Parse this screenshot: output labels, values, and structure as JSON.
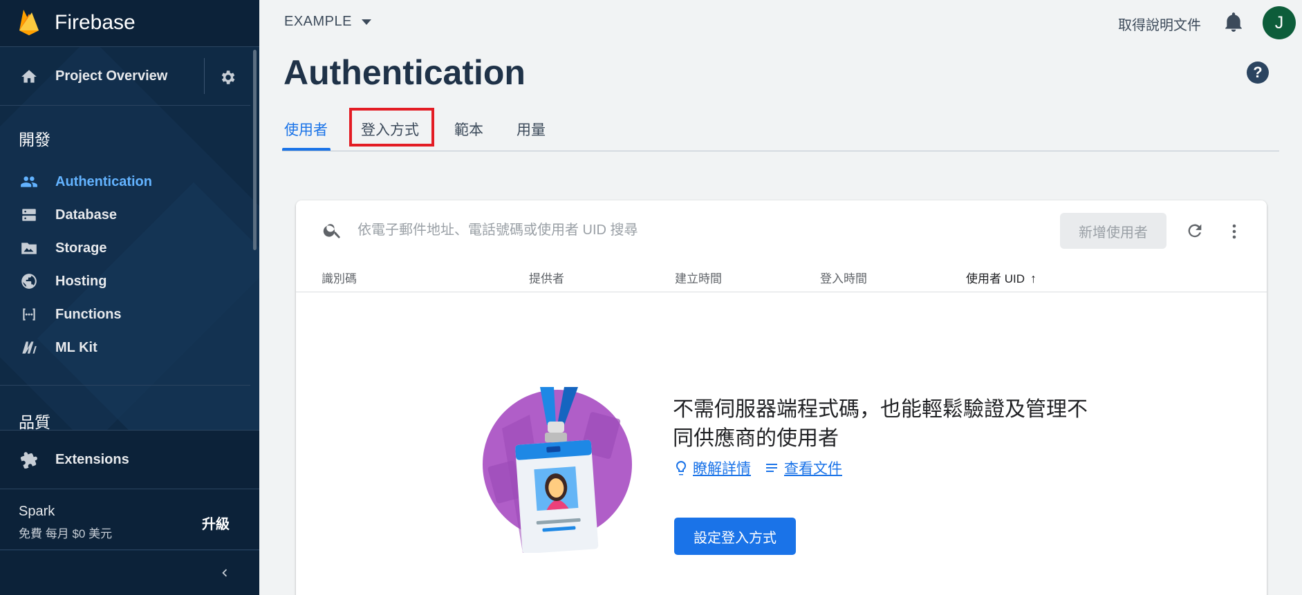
{
  "app": {
    "brand": "Firebase"
  },
  "sidebar": {
    "overview_label": "Project Overview",
    "section_develop": "開發",
    "develop_items": [
      {
        "label": "Authentication",
        "icon": "people-icon"
      },
      {
        "label": "Database",
        "icon": "database-icon"
      },
      {
        "label": "Storage",
        "icon": "image-icon"
      },
      {
        "label": "Hosting",
        "icon": "globe-icon"
      },
      {
        "label": "Functions",
        "icon": "functions-icon"
      },
      {
        "label": "ML Kit",
        "icon": "ml-kit-icon"
      }
    ],
    "section_quality": "品質",
    "extensions_label": "Extensions",
    "plan": {
      "name": "Spark",
      "desc": "免費 每月 $0 美元",
      "upgrade": "升級"
    }
  },
  "header": {
    "project": "EXAMPLE",
    "docs_link": "取得說明文件",
    "avatar_initial": "J",
    "page_title": "Authentication",
    "help": "?"
  },
  "tabs": [
    {
      "label": "使用者",
      "active": true
    },
    {
      "label": "登入方式",
      "active": false
    },
    {
      "label": "範本",
      "active": false
    },
    {
      "label": "用量",
      "active": false
    }
  ],
  "users_table": {
    "search_placeholder": "依電子郵件地址、電話號碼或使用者 UID 搜尋",
    "add_user": "新增使用者",
    "columns": [
      "識別碼",
      "提供者",
      "建立時間",
      "登入時間",
      "使用者 UID"
    ],
    "sort_arrow": "↑"
  },
  "empty_state": {
    "title": "不需伺服器端程式碼，也能輕鬆驗證及管理不同供應商的使用者",
    "learn_more": "瞭解詳情",
    "view_docs": "查看文件",
    "setup_button": "設定登入方式"
  },
  "colors": {
    "accent": "#1a73e8",
    "sidebar": "#0f2a45",
    "highlight": "#e31c24",
    "active_nav": "#63b3ff"
  }
}
